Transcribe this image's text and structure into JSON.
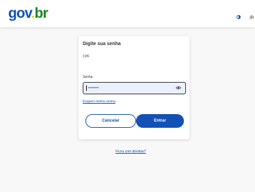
{
  "header": {
    "logo_part1": "gov",
    "logo_dot": ".",
    "logo_part2": "br",
    "contrast_icon": "contrast-icon",
    "accessibility_icon": "vlibras-icon"
  },
  "login": {
    "title": "Digite sua senha",
    "cpf_label": "CPF",
    "password_label": "Senha",
    "password_mask": "••••••••",
    "show_password_icon": "eye-icon",
    "forgot_password": "Esqueci minha senha",
    "cancel_label": "Cancelar",
    "enter_label": "Entrar"
  },
  "footer": {
    "help_link": "Ficou com dúvidas?"
  },
  "colors": {
    "brand_blue": "#1351b4",
    "brand_yellow": "#ffcd07",
    "brand_green": "#168821",
    "input_bg": "#eaf1fd",
    "page_bg": "#f8f8f8"
  }
}
